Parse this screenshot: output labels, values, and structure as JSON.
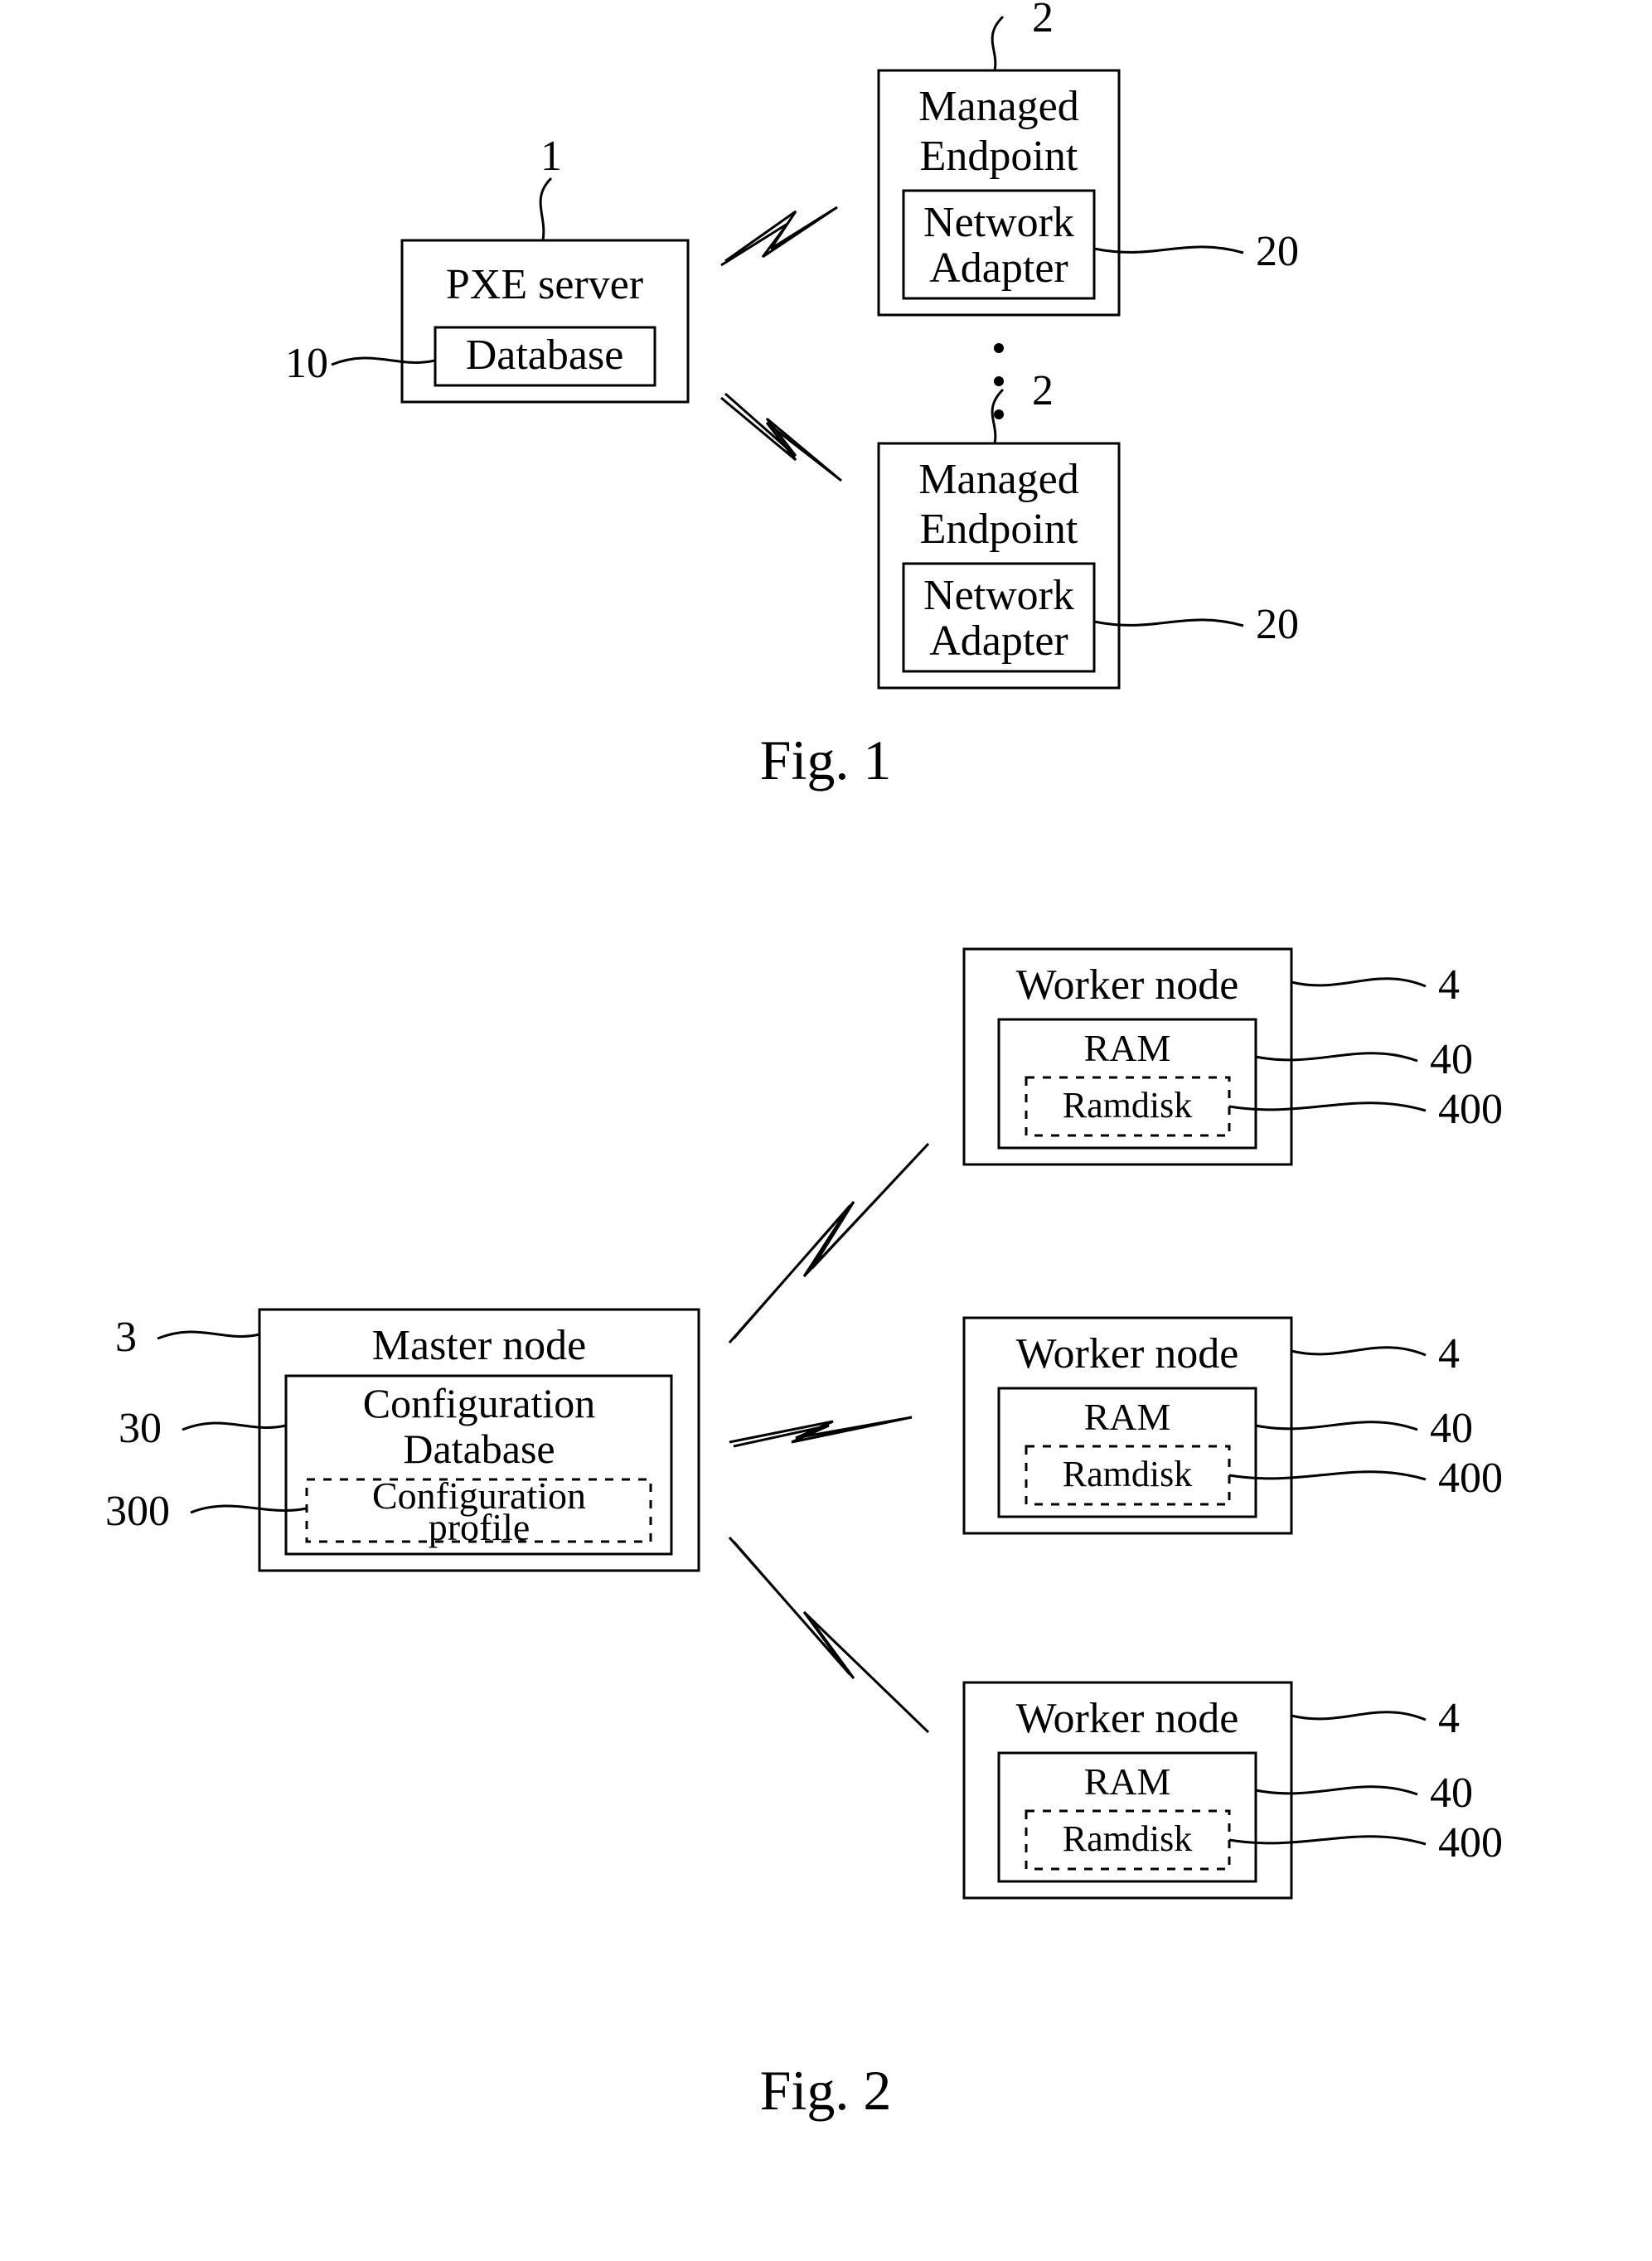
{
  "fig1": {
    "caption": "Fig. 1",
    "pxe": {
      "title": "PXE server",
      "db": "Database",
      "ref": "1",
      "dbRef": "10"
    },
    "endpoint": {
      "title1": "Managed",
      "title2": "Endpoint",
      "adapter1": "Network",
      "adapter2": "Adapter",
      "ref": "2",
      "adapterRef": "20"
    },
    "dots": "⋮"
  },
  "fig2": {
    "caption": "Fig. 2",
    "master": {
      "title": "Master node",
      "db1": "Configuration",
      "db2": "Database",
      "profile1": "Configuration",
      "profile2": "profile",
      "ref": "3",
      "dbRef": "30",
      "profileRef": "300"
    },
    "worker": {
      "title": "Worker node",
      "ram": "RAM",
      "ramdisk": "Ramdisk",
      "ref": "4",
      "ramRef": "40",
      "ramdiskRef": "400"
    }
  }
}
